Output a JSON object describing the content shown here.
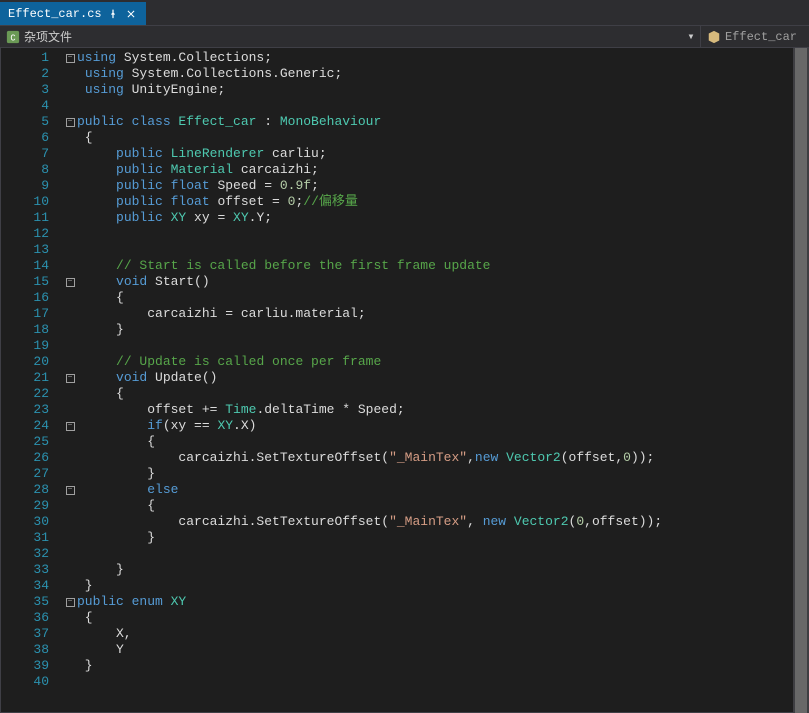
{
  "tab": {
    "filename": "Effect_car.cs"
  },
  "crumb": {
    "left_label": "杂项文件",
    "right_label": "Effect_car"
  },
  "code": {
    "lines": [
      {
        "n": 1,
        "fold": "minus",
        "segs": [
          {
            "t": "using ",
            "c": "kw"
          },
          {
            "t": "System.Collections",
            "c": "id"
          },
          {
            "t": ";",
            "c": "pl"
          }
        ]
      },
      {
        "n": 2,
        "fold": "",
        "segs": [
          {
            "t": " ",
            "c": "pl"
          },
          {
            "t": "using ",
            "c": "kw"
          },
          {
            "t": "System.Collections.Generic",
            "c": "id"
          },
          {
            "t": ";",
            "c": "pl"
          }
        ]
      },
      {
        "n": 3,
        "fold": "",
        "segs": [
          {
            "t": " ",
            "c": "pl"
          },
          {
            "t": "using ",
            "c": "kw"
          },
          {
            "t": "UnityEngine",
            "c": "id"
          },
          {
            "t": ";",
            "c": "pl"
          }
        ]
      },
      {
        "n": 4,
        "fold": "",
        "segs": [
          {
            "t": "",
            "c": "pl"
          }
        ]
      },
      {
        "n": 5,
        "fold": "minus",
        "segs": [
          {
            "t": "public class ",
            "c": "kw"
          },
          {
            "t": "Effect_car",
            "c": "type"
          },
          {
            "t": " : ",
            "c": "pl"
          },
          {
            "t": "MonoBehaviour",
            "c": "type"
          }
        ]
      },
      {
        "n": 6,
        "fold": "",
        "segs": [
          {
            "t": " {",
            "c": "pl"
          }
        ]
      },
      {
        "n": 7,
        "fold": "",
        "segs": [
          {
            "t": "     ",
            "c": "pl"
          },
          {
            "t": "public ",
            "c": "kw"
          },
          {
            "t": "LineRenderer",
            "c": "type"
          },
          {
            "t": " carliu;",
            "c": "pl"
          }
        ]
      },
      {
        "n": 8,
        "fold": "",
        "segs": [
          {
            "t": "     ",
            "c": "pl"
          },
          {
            "t": "public ",
            "c": "kw"
          },
          {
            "t": "Material",
            "c": "type"
          },
          {
            "t": " carcaizhi;",
            "c": "pl"
          }
        ]
      },
      {
        "n": 9,
        "fold": "",
        "segs": [
          {
            "t": "     ",
            "c": "pl"
          },
          {
            "t": "public ",
            "c": "kw"
          },
          {
            "t": "float",
            "c": "kw"
          },
          {
            "t": " Speed = ",
            "c": "pl"
          },
          {
            "t": "0.9f",
            "c": "num"
          },
          {
            "t": ";",
            "c": "pl"
          }
        ]
      },
      {
        "n": 10,
        "fold": "",
        "segs": [
          {
            "t": "     ",
            "c": "pl"
          },
          {
            "t": "public ",
            "c": "kw"
          },
          {
            "t": "float",
            "c": "kw"
          },
          {
            "t": " offset = ",
            "c": "pl"
          },
          {
            "t": "0",
            "c": "num"
          },
          {
            "t": ";",
            "c": "pl"
          },
          {
            "t": "//偏移量",
            "c": "cm"
          }
        ]
      },
      {
        "n": 11,
        "fold": "",
        "segs": [
          {
            "t": "     ",
            "c": "pl"
          },
          {
            "t": "public ",
            "c": "kw"
          },
          {
            "t": "XY",
            "c": "type"
          },
          {
            "t": " xy = ",
            "c": "pl"
          },
          {
            "t": "XY",
            "c": "type"
          },
          {
            "t": ".Y;",
            "c": "pl"
          }
        ]
      },
      {
        "n": 12,
        "fold": "",
        "segs": [
          {
            "t": "",
            "c": "pl"
          }
        ]
      },
      {
        "n": 13,
        "fold": "",
        "segs": [
          {
            "t": "",
            "c": "pl"
          }
        ]
      },
      {
        "n": 14,
        "fold": "",
        "segs": [
          {
            "t": "     ",
            "c": "pl"
          },
          {
            "t": "// Start is called before the first frame update",
            "c": "cm"
          }
        ]
      },
      {
        "n": 15,
        "fold": "minus",
        "segs": [
          {
            "t": "     ",
            "c": "pl"
          },
          {
            "t": "void",
            "c": "kw"
          },
          {
            "t": " Start()",
            "c": "pl"
          }
        ]
      },
      {
        "n": 16,
        "fold": "",
        "segs": [
          {
            "t": "     {",
            "c": "pl"
          }
        ]
      },
      {
        "n": 17,
        "fold": "",
        "segs": [
          {
            "t": "         carcaizhi = carliu.material;",
            "c": "pl"
          }
        ]
      },
      {
        "n": 18,
        "fold": "",
        "segs": [
          {
            "t": "     }",
            "c": "pl"
          }
        ]
      },
      {
        "n": 19,
        "fold": "",
        "segs": [
          {
            "t": "",
            "c": "pl"
          }
        ]
      },
      {
        "n": 20,
        "fold": "",
        "segs": [
          {
            "t": "     ",
            "c": "pl"
          },
          {
            "t": "// Update is called once per frame",
            "c": "cm"
          }
        ]
      },
      {
        "n": 21,
        "fold": "minus",
        "segs": [
          {
            "t": "     ",
            "c": "pl"
          },
          {
            "t": "void",
            "c": "kw"
          },
          {
            "t": " Update()",
            "c": "pl"
          }
        ]
      },
      {
        "n": 22,
        "fold": "",
        "segs": [
          {
            "t": "     {",
            "c": "pl"
          }
        ]
      },
      {
        "n": 23,
        "fold": "",
        "segs": [
          {
            "t": "         offset += ",
            "c": "pl"
          },
          {
            "t": "Time",
            "c": "type"
          },
          {
            "t": ".deltaTime * Speed;",
            "c": "pl"
          }
        ]
      },
      {
        "n": 24,
        "fold": "minus",
        "segs": [
          {
            "t": "         ",
            "c": "pl"
          },
          {
            "t": "if",
            "c": "kw"
          },
          {
            "t": "(xy == ",
            "c": "pl"
          },
          {
            "t": "XY",
            "c": "type"
          },
          {
            "t": ".X)",
            "c": "pl"
          }
        ]
      },
      {
        "n": 25,
        "fold": "",
        "segs": [
          {
            "t": "         {",
            "c": "pl"
          }
        ]
      },
      {
        "n": 26,
        "fold": "",
        "segs": [
          {
            "t": "             carcaizhi.SetTextureOffset(",
            "c": "pl"
          },
          {
            "t": "\"_MainTex\"",
            "c": "str"
          },
          {
            "t": ",",
            "c": "pl"
          },
          {
            "t": "new ",
            "c": "kw"
          },
          {
            "t": "Vector2",
            "c": "type"
          },
          {
            "t": "(offset,",
            "c": "pl"
          },
          {
            "t": "0",
            "c": "num"
          },
          {
            "t": "));",
            "c": "pl"
          }
        ]
      },
      {
        "n": 27,
        "fold": "",
        "segs": [
          {
            "t": "         }",
            "c": "pl"
          }
        ]
      },
      {
        "n": 28,
        "fold": "minus",
        "segs": [
          {
            "t": "         ",
            "c": "pl"
          },
          {
            "t": "else",
            "c": "kw"
          }
        ]
      },
      {
        "n": 29,
        "fold": "",
        "segs": [
          {
            "t": "         {",
            "c": "pl"
          }
        ]
      },
      {
        "n": 30,
        "fold": "",
        "segs": [
          {
            "t": "             carcaizhi.SetTextureOffset(",
            "c": "pl"
          },
          {
            "t": "\"_MainTex\"",
            "c": "str"
          },
          {
            "t": ", ",
            "c": "pl"
          },
          {
            "t": "new ",
            "c": "kw"
          },
          {
            "t": "Vector2",
            "c": "type"
          },
          {
            "t": "(",
            "c": "pl"
          },
          {
            "t": "0",
            "c": "num"
          },
          {
            "t": ",offset));",
            "c": "pl"
          }
        ]
      },
      {
        "n": 31,
        "fold": "",
        "segs": [
          {
            "t": "         }",
            "c": "pl"
          }
        ]
      },
      {
        "n": 32,
        "fold": "",
        "segs": [
          {
            "t": "",
            "c": "pl"
          }
        ]
      },
      {
        "n": 33,
        "fold": "",
        "segs": [
          {
            "t": "     }",
            "c": "pl"
          }
        ]
      },
      {
        "n": 34,
        "fold": "",
        "segs": [
          {
            "t": " }",
            "c": "pl"
          }
        ]
      },
      {
        "n": 35,
        "fold": "minus",
        "segs": [
          {
            "t": "public enum ",
            "c": "kw"
          },
          {
            "t": "XY",
            "c": "type"
          }
        ]
      },
      {
        "n": 36,
        "fold": "",
        "segs": [
          {
            "t": " {",
            "c": "pl"
          }
        ]
      },
      {
        "n": 37,
        "fold": "",
        "segs": [
          {
            "t": "     X,",
            "c": "pl"
          }
        ]
      },
      {
        "n": 38,
        "fold": "",
        "segs": [
          {
            "t": "     Y",
            "c": "pl"
          }
        ]
      },
      {
        "n": 39,
        "fold": "",
        "segs": [
          {
            "t": " }",
            "c": "pl"
          }
        ]
      },
      {
        "n": 40,
        "fold": "",
        "segs": [
          {
            "t": "",
            "c": "pl"
          }
        ]
      }
    ]
  }
}
